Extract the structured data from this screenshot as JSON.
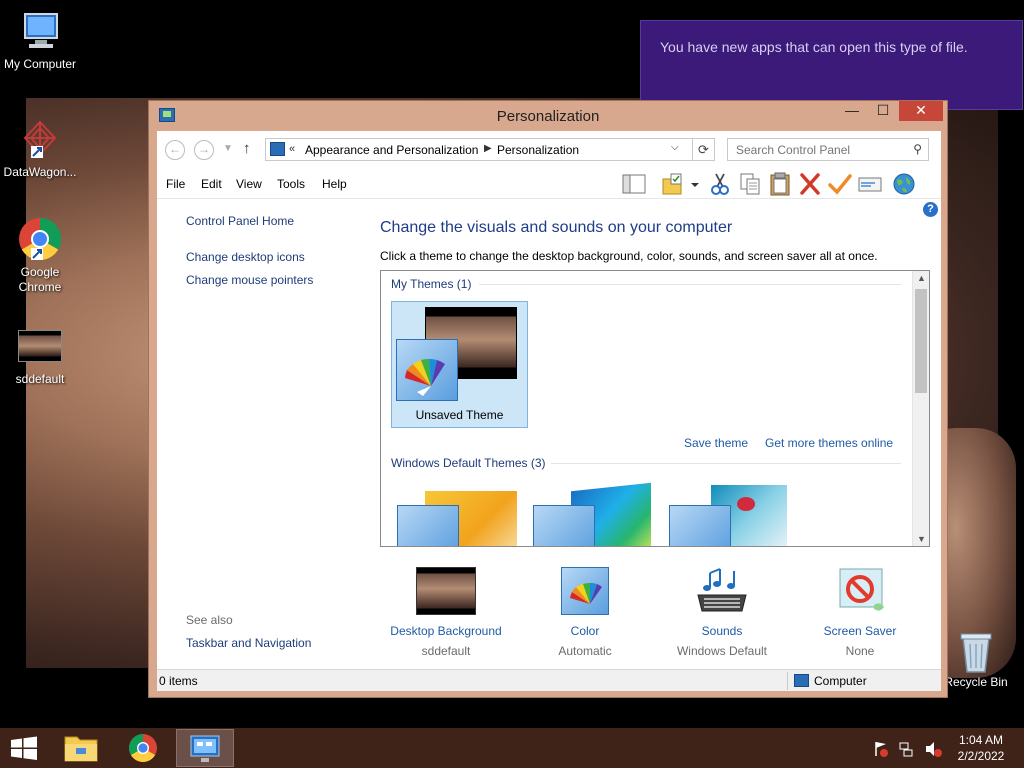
{
  "desktop": {
    "icons": [
      {
        "label": "My Computer"
      },
      {
        "label": "DataWagon..."
      },
      {
        "label": "Google Chrome"
      },
      {
        "label": "sddefault"
      },
      {
        "label": "Recycle Bin"
      }
    ]
  },
  "toast": {
    "message": "You have new apps that can open this type of file."
  },
  "window": {
    "title": "Personalization",
    "controls": {
      "minimize": "—",
      "maximize": "☐",
      "close": "✕"
    },
    "nav": {
      "breadcrumb_overflow": "«",
      "breadcrumb": [
        "Appearance and Personalization",
        "Personalization"
      ],
      "search_placeholder": "Search Control Panel"
    },
    "menu": [
      "File",
      "Edit",
      "View",
      "Tools",
      "Help"
    ],
    "toolbar_icons": [
      "layout-pane-icon",
      "folder-options-icon",
      "cut-icon",
      "copy-icon",
      "paste-icon",
      "delete-icon",
      "properties-check-icon",
      "mail-icon",
      "globe-icon"
    ],
    "left_pane": {
      "home": "Control Panel Home",
      "links": [
        "Change desktop icons",
        "Change mouse pointers"
      ],
      "see_also_label": "See also",
      "see_also_links": [
        "Taskbar and Navigation"
      ]
    },
    "main": {
      "heading": "Change the visuals and sounds on your computer",
      "description": "Click a theme to change the desktop background, color, sounds, and screen saver all at once.",
      "my_themes_header": "My Themes (1)",
      "unsaved_theme_label": "Unsaved Theme",
      "save_theme_link": "Save theme",
      "get_more_link": "Get more themes online",
      "default_themes_header": "Windows Default Themes (3)"
    },
    "bottom": [
      {
        "name": "Desktop Background",
        "value": "sddefault"
      },
      {
        "name": "Color",
        "value": "Automatic"
      },
      {
        "name": "Sounds",
        "value": "Windows Default"
      },
      {
        "name": "Screen Saver",
        "value": "None"
      }
    ],
    "status": {
      "items": "0 items",
      "location": "Computer"
    }
  },
  "taskbar": {
    "time": "1:04 AM",
    "date": "2/2/2022"
  }
}
